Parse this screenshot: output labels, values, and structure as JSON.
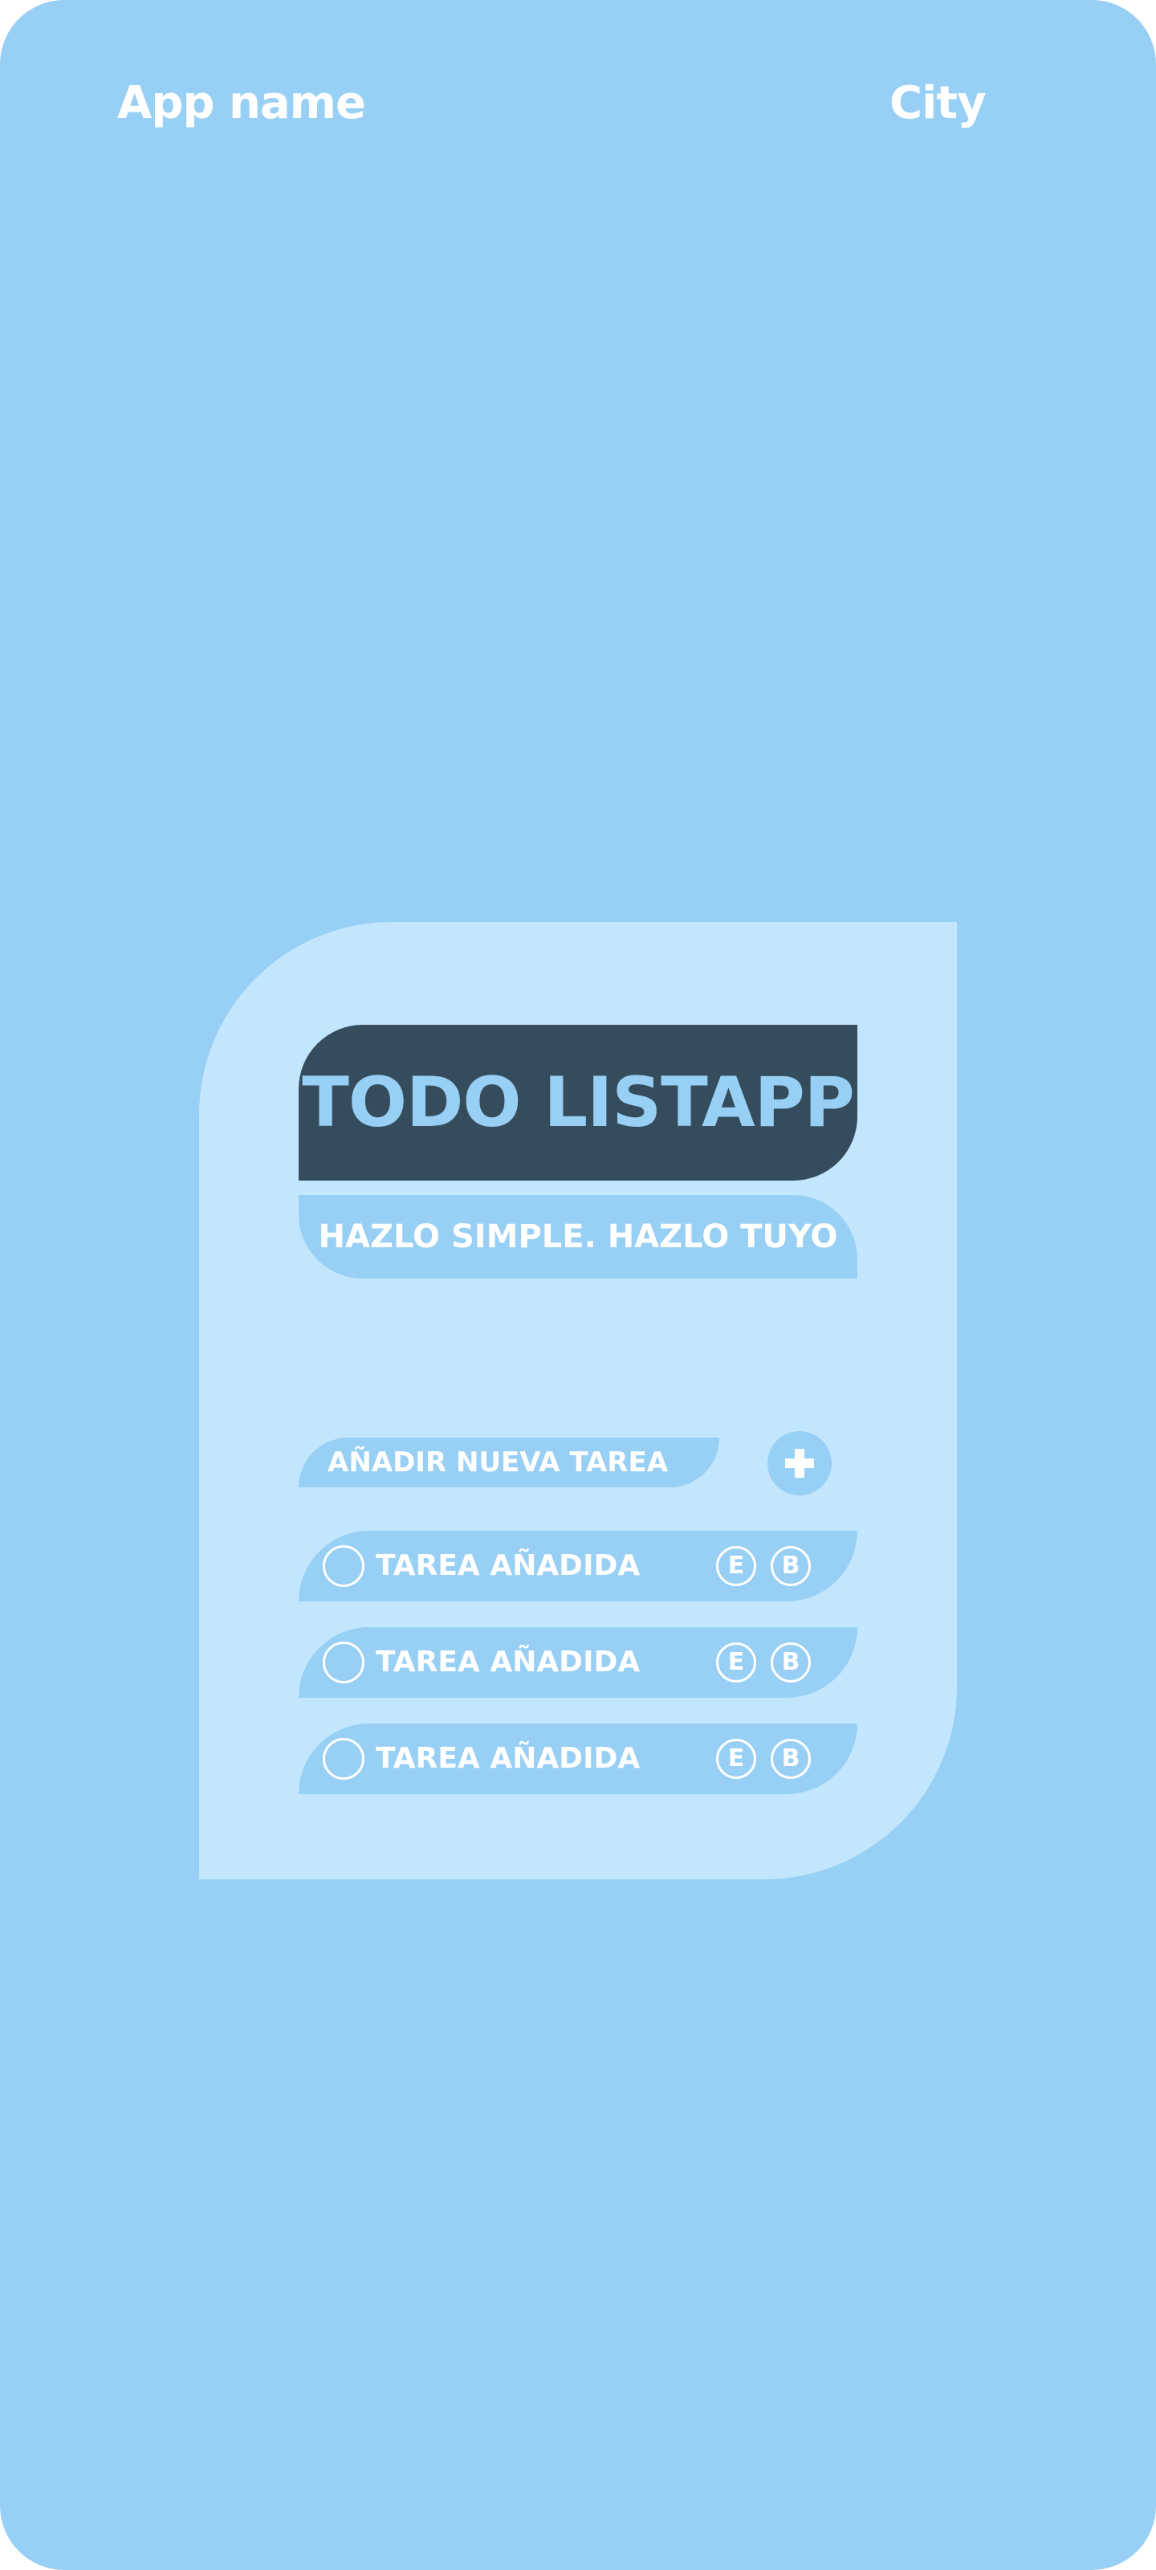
{
  "header": {
    "app_name": "App name",
    "city": "City"
  },
  "card": {
    "title": "TODO LISTAPP",
    "subtitle": "HAZLO SIMPLE. HAZLO TUYO",
    "new_task_label": "AÑADIR NUEVA TAREA",
    "add_icon": "plus-icon",
    "tasks": [
      {
        "label": "TAREA AÑADIDA",
        "completed": false,
        "edit_label": "E",
        "delete_label": "B"
      },
      {
        "label": "TAREA AÑADIDA",
        "completed": false,
        "edit_label": "E",
        "delete_label": "B"
      },
      {
        "label": "TAREA AÑADIDA",
        "completed": false,
        "edit_label": "E",
        "delete_label": "B"
      }
    ]
  },
  "colors": {
    "background": "#98cff4",
    "card": "#c2e6fd",
    "title_block": "#354c5d",
    "text": "#ffffff"
  }
}
